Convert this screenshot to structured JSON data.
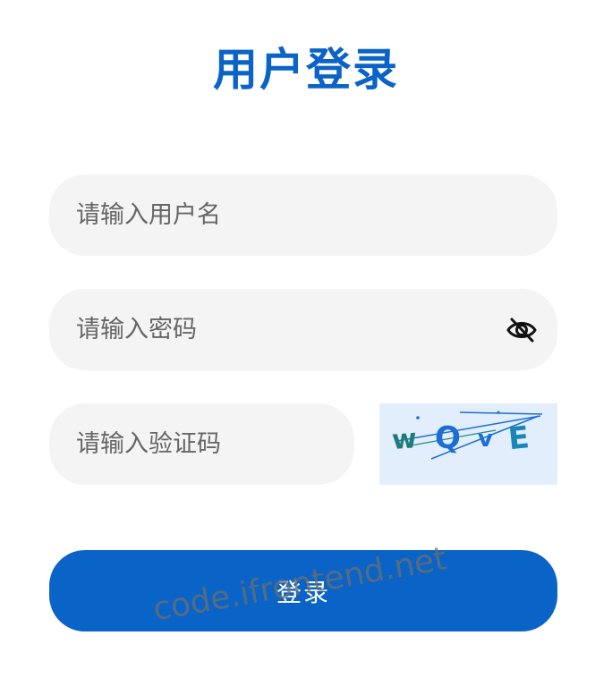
{
  "header": {
    "title": "用户登录"
  },
  "form": {
    "username": {
      "value": "",
      "placeholder": "请输入用户名"
    },
    "password": {
      "value": "",
      "placeholder": "请输入密码",
      "toggle_icon": "eye-off-icon"
    },
    "captcha": {
      "value": "",
      "placeholder": "请输入验证码",
      "code": [
        "w",
        "Q",
        "v",
        "E"
      ]
    },
    "submit_label": "登录"
  },
  "watermark": "code.ifrontend.net",
  "colors": {
    "primary": "#0a63c6",
    "field_bg": "#f4f4f4",
    "captcha_bg": "#e3eefc"
  }
}
